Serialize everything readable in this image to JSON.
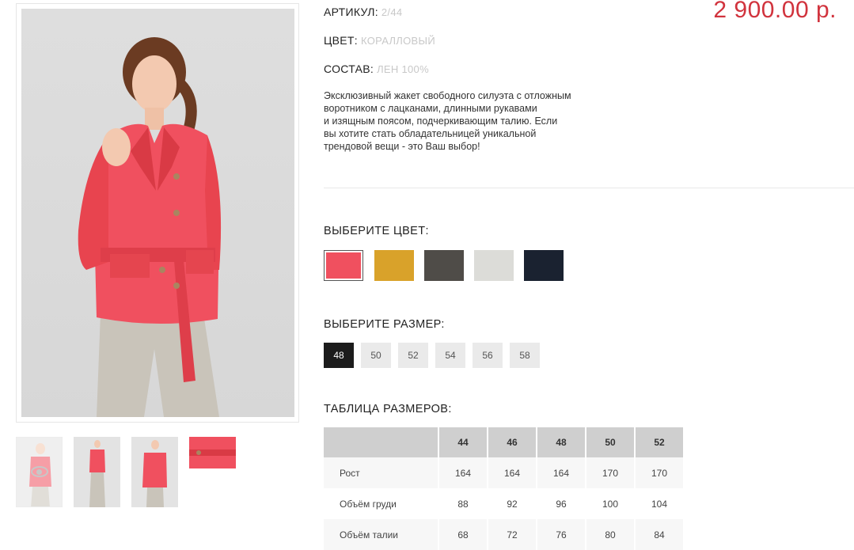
{
  "product": {
    "article_label": "АРТИКУЛ:",
    "article_value": "2/44",
    "color_label": "ЦВЕТ:",
    "color_value": "КОРАЛЛОВЫЙ",
    "composition_label": "СОСТАВ:",
    "composition_value": "ЛЕН 100%",
    "price": "2 900.00 р.",
    "description": [
      "Эксклюзивный жакет свободного силуэта с отложным",
      "воротником с лацканами, длинными рукавами",
      "и изящным поясом, подчеркивающим талию. Если",
      "вы хотите стать обладательницей уникальной",
      "трендовой вещи - это Ваш выбор!"
    ]
  },
  "gallery": {
    "thumbnails": [
      {
        "name": "thumbnail-front",
        "active": true
      },
      {
        "name": "thumbnail-full-length",
        "active": false
      },
      {
        "name": "thumbnail-side",
        "active": false
      },
      {
        "name": "thumbnail-detail",
        "active": false
      }
    ],
    "zoom_icon": "eye-icon"
  },
  "color_select": {
    "title": "ВЫБЕРИТЕ ЦВЕТ:",
    "swatches": [
      "#f0505f",
      "#d9a22a",
      "#4f4c48",
      "#dcdcd8",
      "#1a2230"
    ],
    "selected_index": 0
  },
  "size_select": {
    "title": "ВЫБЕРИТЕ РАЗМЕР:",
    "sizes": [
      "48",
      "50",
      "52",
      "54",
      "56",
      "58"
    ],
    "selected_index": 0
  },
  "size_table": {
    "title": "ТАБЛИЦА РАЗМЕРОВ:",
    "headers": [
      "",
      "44",
      "46",
      "48",
      "50",
      "52"
    ],
    "rows": [
      {
        "label": "Рост",
        "values": [
          "164",
          "164",
          "164",
          "170",
          "170"
        ]
      },
      {
        "label": "Объём груди",
        "values": [
          "88",
          "92",
          "96",
          "100",
          "104"
        ]
      },
      {
        "label": "Объём талии",
        "values": [
          "68",
          "72",
          "76",
          "80",
          "84"
        ]
      }
    ]
  },
  "colors": {
    "price": "#d1333d",
    "jacket": "#f0505f",
    "size_selected_bg": "#1c1c1c",
    "table_header_bg": "#cfcfcf"
  }
}
